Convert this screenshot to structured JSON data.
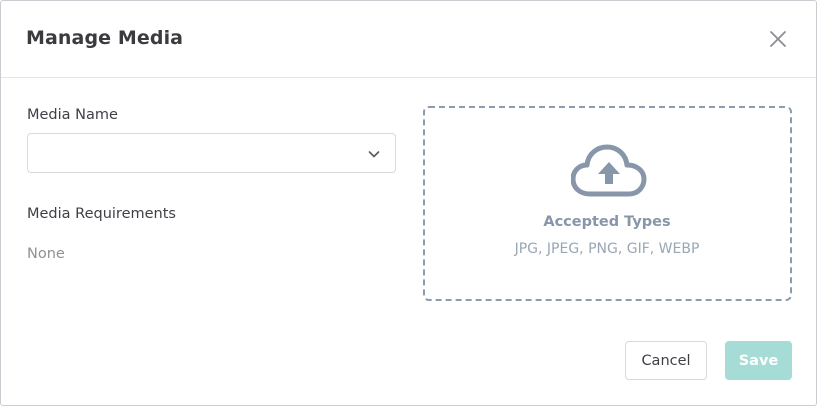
{
  "dialog": {
    "title": "Manage Media",
    "close_icon": "close-icon"
  },
  "form": {
    "media_name_label": "Media Name",
    "media_name_value": "",
    "dropdown_icon": "chevron-down-icon",
    "requirements_label": "Media Requirements",
    "requirements_value": "None"
  },
  "upload": {
    "icon": "cloud-upload-icon",
    "title": "Accepted Types",
    "types": "JPG, JPEG, PNG, GIF, WEBP"
  },
  "footer": {
    "cancel_label": "Cancel",
    "save_label": "Save",
    "save_enabled": false
  },
  "colors": {
    "save_button": "#a5dcd5",
    "dropzone_border": "#8c9bad",
    "icon": "#8796a8"
  }
}
